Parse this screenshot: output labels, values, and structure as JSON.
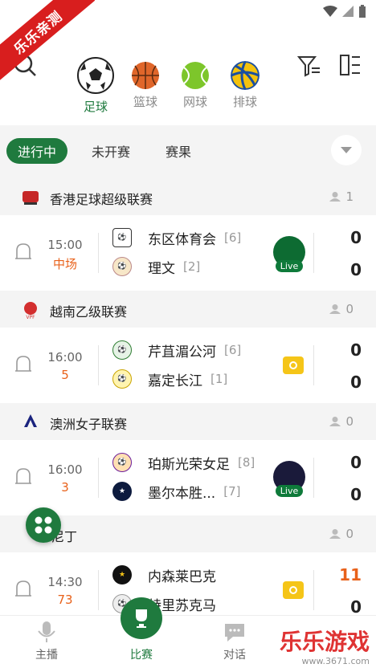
{
  "watermark_top": "乐乐亲测",
  "sports": [
    {
      "label": "足球",
      "active": true
    },
    {
      "label": "篮球",
      "active": false
    },
    {
      "label": "网球",
      "active": false
    },
    {
      "label": "排球",
      "active": false
    }
  ],
  "status_tabs": [
    "进行中",
    "未开赛",
    "赛果"
  ],
  "leagues": [
    {
      "name": "香港足球超级联赛",
      "count": "1"
    },
    {
      "name": "越南乙级联赛",
      "count": "0"
    },
    {
      "name": "澳洲女子联赛",
      "count": "0"
    },
    {
      "name": "尼丁",
      "count": "0"
    }
  ],
  "matches": [
    {
      "time": "15:00",
      "minute": "中场",
      "home": "东区体育会",
      "home_rank": "[6]",
      "away": "理文",
      "away_rank": "[2]",
      "home_score": "0",
      "away_score": "0",
      "media": "live",
      "live_label": "Live"
    },
    {
      "time": "16:00",
      "minute": "5",
      "home": "芹苴湄公河",
      "home_rank": "[6]",
      "away": "嘉定长江",
      "away_rank": "[1]",
      "home_score": "0",
      "away_score": "0",
      "media": "video"
    },
    {
      "time": "16:00",
      "minute": "3",
      "home": "珀斯光荣女足",
      "home_rank": "[8]",
      "away": "墨尔本胜...",
      "away_rank": "[7]",
      "home_score": "0",
      "away_score": "0",
      "media": "live",
      "live_label": "Live"
    },
    {
      "time": "14:30",
      "minute": "73",
      "home": "内森莱巴克",
      "home_rank": "",
      "away": "特里苏克马",
      "away_rank": "",
      "home_score": "11",
      "away_score": "0",
      "media": "video"
    }
  ],
  "bottom_nav": [
    "主播",
    "比赛",
    "对话"
  ],
  "watermark_bottom": {
    "title": "乐乐游戏",
    "url": "www.3671.com"
  },
  "colors": {
    "accent": "#1f7a3e",
    "hot": "#e8611a",
    "ribbon": "#d81e1e"
  }
}
